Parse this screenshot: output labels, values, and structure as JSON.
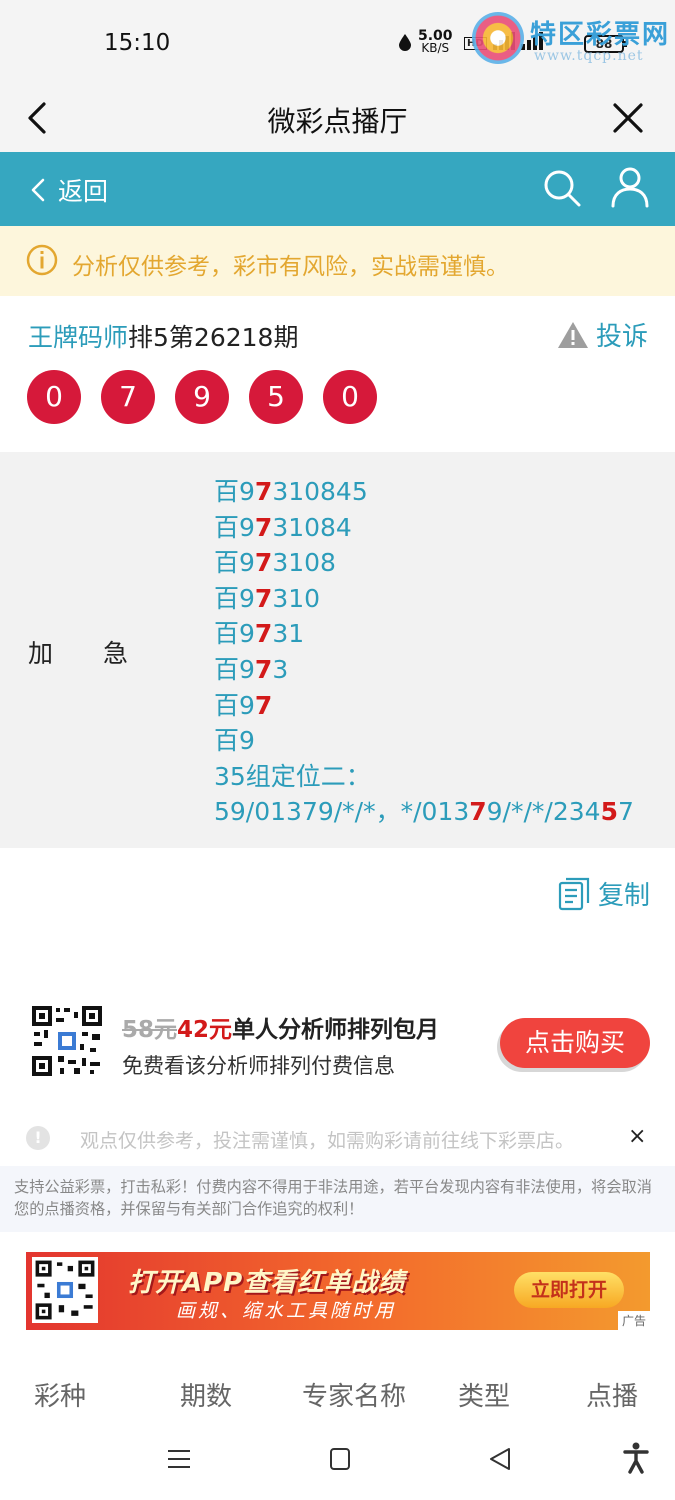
{
  "status_bar": {
    "time": "15:10",
    "net_speed": "5.00",
    "net_unit": "KB/S",
    "hd": "HD",
    "battery": "88"
  },
  "watermark": {
    "title": "特区彩票网",
    "url": "www.tqcp.net"
  },
  "titlebar": {
    "title": "微彩点播厅"
  },
  "nav": {
    "back_label": "返回"
  },
  "notice": {
    "text": "分析仅供参考，彩市有风险，实战需谨慎。"
  },
  "header": {
    "expert_name": "王牌码师",
    "issue": "排5第26218期",
    "complain_label": "投诉"
  },
  "balls": [
    "0",
    "7",
    "9",
    "5",
    "0"
  ],
  "content": {
    "label": "加急",
    "lines": [
      {
        "pre": "百9",
        "hit": "7",
        "post": "310845"
      },
      {
        "pre": "百9",
        "hit": "7",
        "post": "31084"
      },
      {
        "pre": "百9",
        "hit": "7",
        "post": "3108"
      },
      {
        "pre": "百9",
        "hit": "7",
        "post": "310"
      },
      {
        "pre": "百9",
        "hit": "7",
        "post": "31"
      },
      {
        "pre": "百9",
        "hit": "7",
        "post": "3"
      },
      {
        "pre": "百9",
        "hit": "7",
        "post": ""
      },
      {
        "pre": "百9",
        "hit": "",
        "post": ""
      }
    ],
    "group_title": "35组定位二：",
    "group_parts": [
      "59/01379/*/*，*/013",
      "7",
      "9/*/*/234",
      "5",
      "7"
    ]
  },
  "copy_label": "复制",
  "promo": {
    "old_price": "58元",
    "new_price": "42元",
    "desc": "单人分析师排列包月",
    "sub": "免费看该分析师排列付费信息",
    "buy_label": "点击购买"
  },
  "disclaimer": {
    "text": "观点仅供参考，投注需谨慎，如需购彩请前往线下彩票店。",
    "close": "×"
  },
  "legal": "支持公益彩票，打击私彩！付费内容不得用于非法用途，若平台发现内容有非法使用，将会取消您的点播资格，并保留与有关部门合作追究的权利！",
  "banner": {
    "line1": "打开APP查看红单战绩",
    "line2": "画规、缩水工具随时用",
    "open_label": "立即打开",
    "ad_tag": "广告"
  },
  "tabs": [
    "彩种",
    "期数",
    "专家名称",
    "类型",
    "点播"
  ],
  "colors": {
    "accent": "#36a7c0",
    "ball_red": "#d6193a",
    "notice_text": "#e3a730",
    "buy_button": "#f0443e"
  },
  "icons": [
    "back-chevron-icon",
    "close-x-icon",
    "search-icon",
    "user-icon",
    "info-circle-icon",
    "warning-triangle-icon",
    "copy-document-icon",
    "qr-code-icon",
    "menu-icon",
    "home-square-icon",
    "back-triangle-icon",
    "accessibility-icon"
  ]
}
